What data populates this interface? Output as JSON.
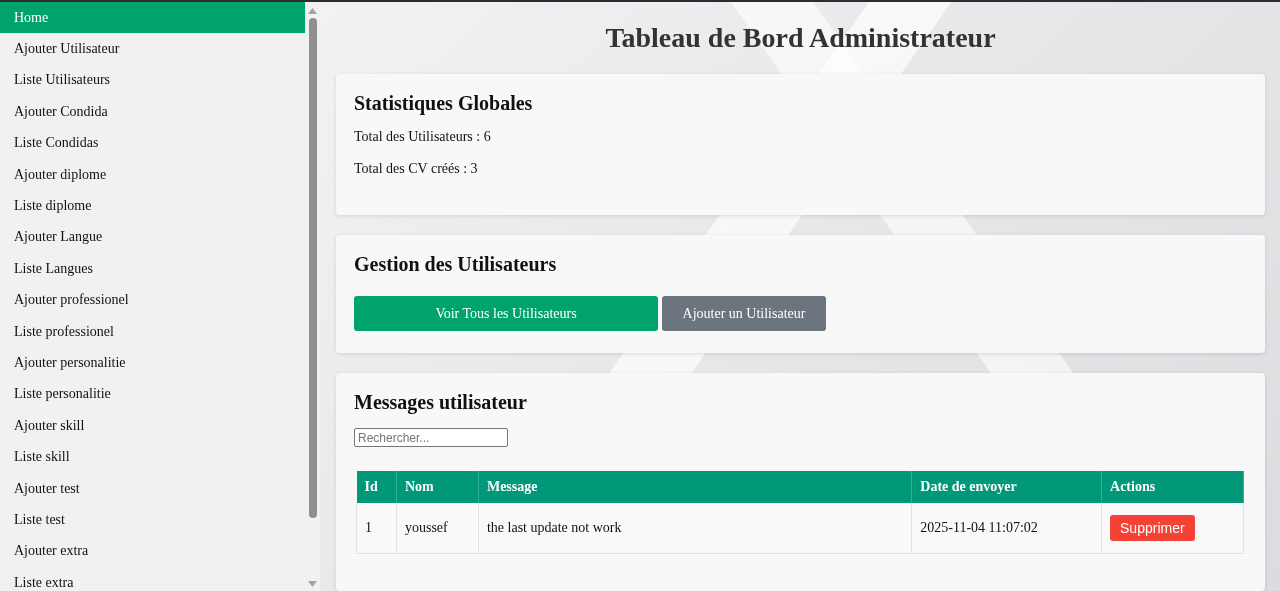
{
  "sidebar": {
    "items": [
      {
        "label": "Home",
        "selected": true
      },
      {
        "label": "Ajouter Utilisateur",
        "selected": false
      },
      {
        "label": "Liste Utilisateurs",
        "selected": false
      },
      {
        "label": "Ajouter Condida",
        "selected": false
      },
      {
        "label": "Liste Condidas",
        "selected": false
      },
      {
        "label": "Ajouter diplome",
        "selected": false
      },
      {
        "label": "Liste diplome",
        "selected": false
      },
      {
        "label": "Ajouter Langue",
        "selected": false
      },
      {
        "label": "Liste Langues",
        "selected": false
      },
      {
        "label": "Ajouter professionel",
        "selected": false
      },
      {
        "label": "Liste professionel",
        "selected": false
      },
      {
        "label": "Ajouter personalitie",
        "selected": false
      },
      {
        "label": "Liste personalitie",
        "selected": false
      },
      {
        "label": "Ajouter skill",
        "selected": false
      },
      {
        "label": "Liste skill",
        "selected": false
      },
      {
        "label": "Ajouter test",
        "selected": false
      },
      {
        "label": "Liste test",
        "selected": false
      },
      {
        "label": "Ajouter extra",
        "selected": false
      },
      {
        "label": "Liste extra",
        "selected": false
      }
    ]
  },
  "title": "Tableau de Bord Administrateur",
  "stats": {
    "heading": "Statistiques Globales",
    "lines": [
      "Total des Utilisateurs : 6",
      "Total des CV créés : 3"
    ]
  },
  "users": {
    "heading": "Gestion des Utilisateurs",
    "buttons": [
      {
        "label": "Voir Tous les Utilisateurs",
        "kind": "primary"
      },
      {
        "label": "Ajouter un Utilisateur",
        "kind": "secondary"
      }
    ]
  },
  "messages": {
    "heading": "Messages utilisateur",
    "search": {
      "placeholder": "Rechercher..."
    },
    "columns": [
      "Id",
      "Nom",
      "Message",
      "Date de envoyer",
      "Actions"
    ],
    "rows": [
      {
        "cells": [
          "1",
          "youssef",
          "the last update not work",
          "2025-11-04 11:07:02"
        ],
        "action": "Supprimer"
      }
    ]
  }
}
